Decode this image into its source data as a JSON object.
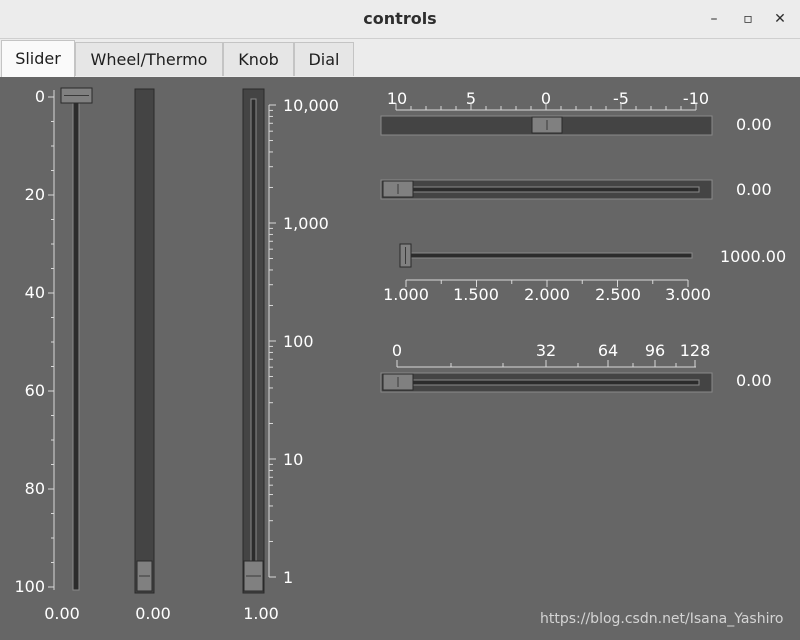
{
  "window": {
    "title": "controls"
  },
  "window_buttons": {
    "minimize": "–",
    "maximize": "▫",
    "close": "✕"
  },
  "tabs": [
    {
      "label": "Slider",
      "active": true
    },
    {
      "label": "Wheel/Thermo",
      "active": false
    },
    {
      "label": "Knob",
      "active": false
    },
    {
      "label": "Dial",
      "active": false
    }
  ],
  "slider1": {
    "tick_labels": [
      "0",
      "20",
      "40",
      "60",
      "80",
      "100"
    ],
    "value_label": "0.00",
    "level": 0
  },
  "slider2": {
    "value_label": "0.00",
    "level": 0
  },
  "slider3": {
    "tick_labels": [
      "10,000",
      "1,000",
      "100",
      "10",
      "1"
    ],
    "value_label": "1.00",
    "level": 0
  },
  "hslider1": {
    "tick_labels": [
      "10",
      "5",
      "0",
      "-5",
      "-10"
    ],
    "value_label": "0.00",
    "level": 0.5
  },
  "hslider2": {
    "value_label": "0.00",
    "level": 0
  },
  "hslider3": {
    "tick_labels": [
      "1.000",
      "1.500",
      "2.000",
      "2.500",
      "3.000"
    ],
    "value_label": "1000.00",
    "level": 0
  },
  "hslider4": {
    "tick_labels": [
      "0",
      "32",
      "64",
      "96",
      "128"
    ],
    "value_label": "0.00",
    "level": 0
  },
  "watermark": "https://blog.csdn.net/Isana_Yashiro",
  "colors": {
    "panel_bg": "#666666",
    "groove": "#3f3f3f",
    "handle": "#808080"
  }
}
